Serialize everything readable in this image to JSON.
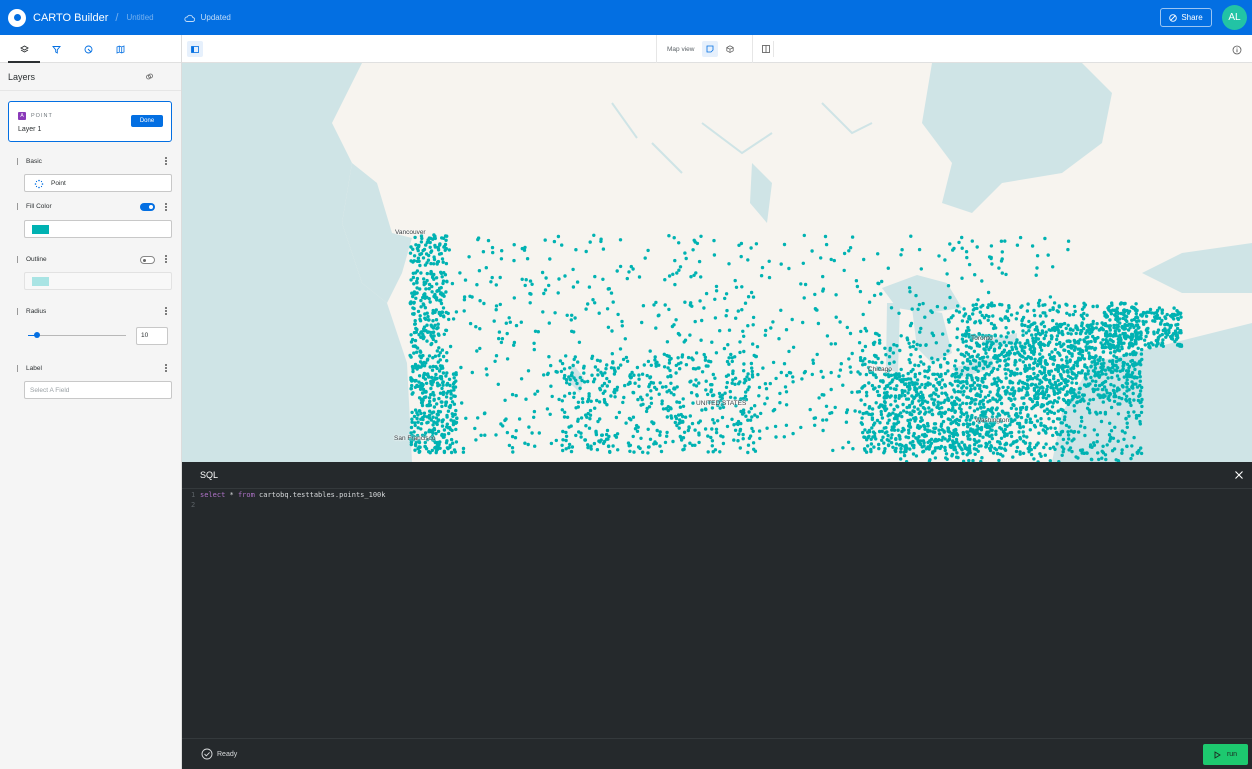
{
  "header": {
    "app_title": "CARTO Builder",
    "separator": "/",
    "map_name": "Untitled",
    "save_status": "Updated",
    "share_label": "Share",
    "user_initials": "AL",
    "brand_color": "#036fe2"
  },
  "sidebar": {
    "tabs": [
      "layers-icon",
      "filter-icon",
      "interactions-icon",
      "basemap-icon"
    ],
    "panel_title": "Layers",
    "layer": {
      "badge": "A",
      "type": "POINT",
      "name": "Layer 1",
      "done_label": "Done"
    },
    "sections": {
      "basic": {
        "label": "Basic",
        "value": "Point"
      },
      "fill": {
        "label": "Fill Color",
        "enabled": true,
        "color": "#00b2b2"
      },
      "outline": {
        "label": "Outline",
        "enabled": false,
        "color": "#a9e4e4"
      },
      "radius": {
        "label": "Radius",
        "value": "10"
      },
      "label": {
        "label": "Label",
        "placeholder": "Select A Field"
      }
    }
  },
  "toolbar": {
    "map_view_label": "Map view"
  },
  "map": {
    "point_color": "#00b2b2",
    "water_color": "#cfe4e6",
    "land_color": "#f7f4ef",
    "labels": [
      "Vancouver",
      "Toronto",
      "UNITED STATES",
      "San Francisco",
      "Chicago",
      "Washington"
    ]
  },
  "sql": {
    "title": "SQL",
    "line_numbers": [
      "1",
      "2"
    ],
    "query_keyword_1": "select",
    "query_op": " * ",
    "query_keyword_2": "from",
    "query_table": " cartobq.testtables.points_100k",
    "status": "Ready",
    "run_label": "run"
  }
}
